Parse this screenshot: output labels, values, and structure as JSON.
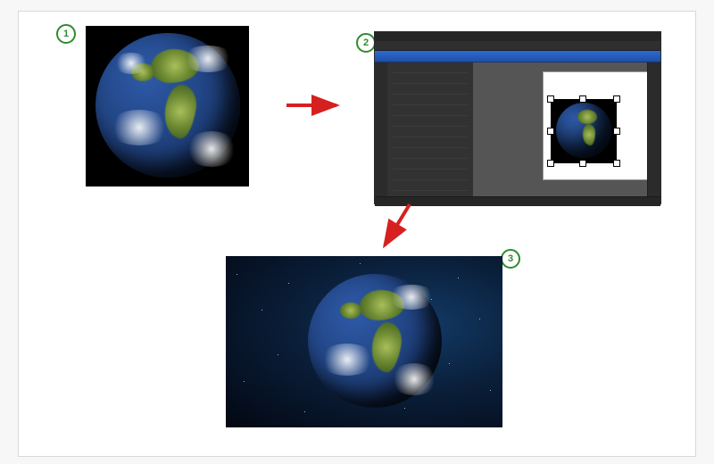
{
  "steps": {
    "s1": {
      "badge": "1"
    },
    "s2": {
      "badge": "2"
    },
    "s3": {
      "badge": "3"
    }
  },
  "colors": {
    "arrow": "#d62020",
    "badge_border": "#2e8b2e",
    "editor_accent": "#2d6bd1"
  }
}
